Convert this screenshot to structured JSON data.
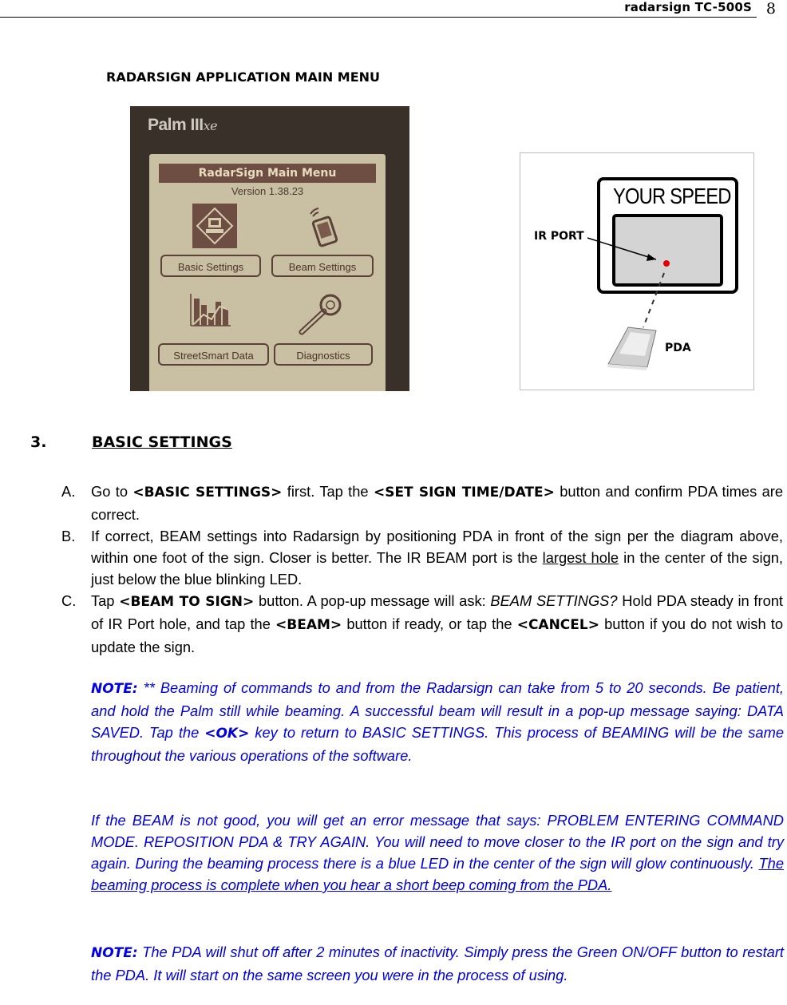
{
  "header": {
    "doc_title": "radarsign TC-500S",
    "page_number": "8"
  },
  "figure_caption": "RADARSIGN APPLICATION MAIN MENU",
  "palm_photo": {
    "device_brand": "Palm",
    "device_model": "III",
    "device_suffix": "xe",
    "screen_title": "RadarSign Main Menu",
    "version": "Version 1.38.23",
    "buttons": [
      "Basic Settings",
      "Beam Settings",
      "StreetSmart Data",
      "Diagnostics"
    ],
    "icons": [
      "basic-settings-icon",
      "beam-settings-icon",
      "streetsmart-data-chart-icon",
      "diagnostics-wrench-icon"
    ],
    "colors": {
      "bezel": "#3a302a",
      "screen": "#c9bfa2",
      "title_bar": "#6e4e42"
    }
  },
  "diagram": {
    "sign_label": "YOUR SPEED",
    "ir_port_label": "IR PORT",
    "pda_label": "PDA",
    "colors": {
      "ir_dot": "#e00000",
      "panel": "#d4d4d4"
    }
  },
  "section": {
    "number": "3.",
    "title": "BASIC SETTINGS"
  },
  "steps": [
    {
      "marker": "A.",
      "t1": "Go to ",
      "b1": "<BASIC SETTINGS>",
      "t2": " first.  Tap the ",
      "b2": "<SET SIGN TIME/DATE>",
      "t3": " button and confirm PDA times are correct."
    },
    {
      "marker": "B.",
      "t1": "If correct, BEAM settings into Radarsign by positioning PDA in front of the sign per the diagram above, within one foot of the sign.  Closer is better.  The IR BEAM port is the ",
      "u1": "largest hole",
      "t2": " in the center of the sign, just below the blue blinking LED."
    },
    {
      "marker": "C.",
      "t1": "Tap ",
      "b1": "<BEAM TO SIGN>",
      "t2": " button.  A pop-up message will ask:  ",
      "i1": "BEAM SETTINGS?",
      "t3": " Hold PDA steady in front of IR Port hole, and tap the ",
      "b2": "<BEAM>",
      "t4": " button if ready, or tap the ",
      "b3": "<CANCEL>",
      "t5": " button if you do not wish to update the sign."
    }
  ],
  "notes": {
    "note1": {
      "label": "NOTE:",
      "t1": " ** Beaming of commands to and from the Radarsign can take from 5 to 20 seconds.  Be patient, and hold the Palm still while beaming.  A successful beam will result in a pop-up message saying: DATA SAVED.  Tap the ",
      "b1": "<OK>",
      "t2": " key to return to BASIC SETTINGS.  This process of BEAMING will be the same throughout the various operations of the software."
    },
    "error": {
      "t1": "If the BEAM is not good, you will get an error message that says: PROBLEM ENTERING COMMAND MODE.  REPOSITION PDA & TRY AGAIN.  You will need to move closer to the IR port on the sign and try again.  During the beaming process there is a blue LED in the center of the sign will glow continuously.  ",
      "u1": "The beaming process is complete when you hear a short beep coming from the PDA."
    },
    "note2": {
      "label": "NOTE:",
      "t1": "  The PDA will shut off after 2 minutes of inactivity.  Simply press the Green ON/OFF button to restart the PDA.  It will start on the same screen you were in the process of using."
    },
    "color": "#0000e0"
  }
}
